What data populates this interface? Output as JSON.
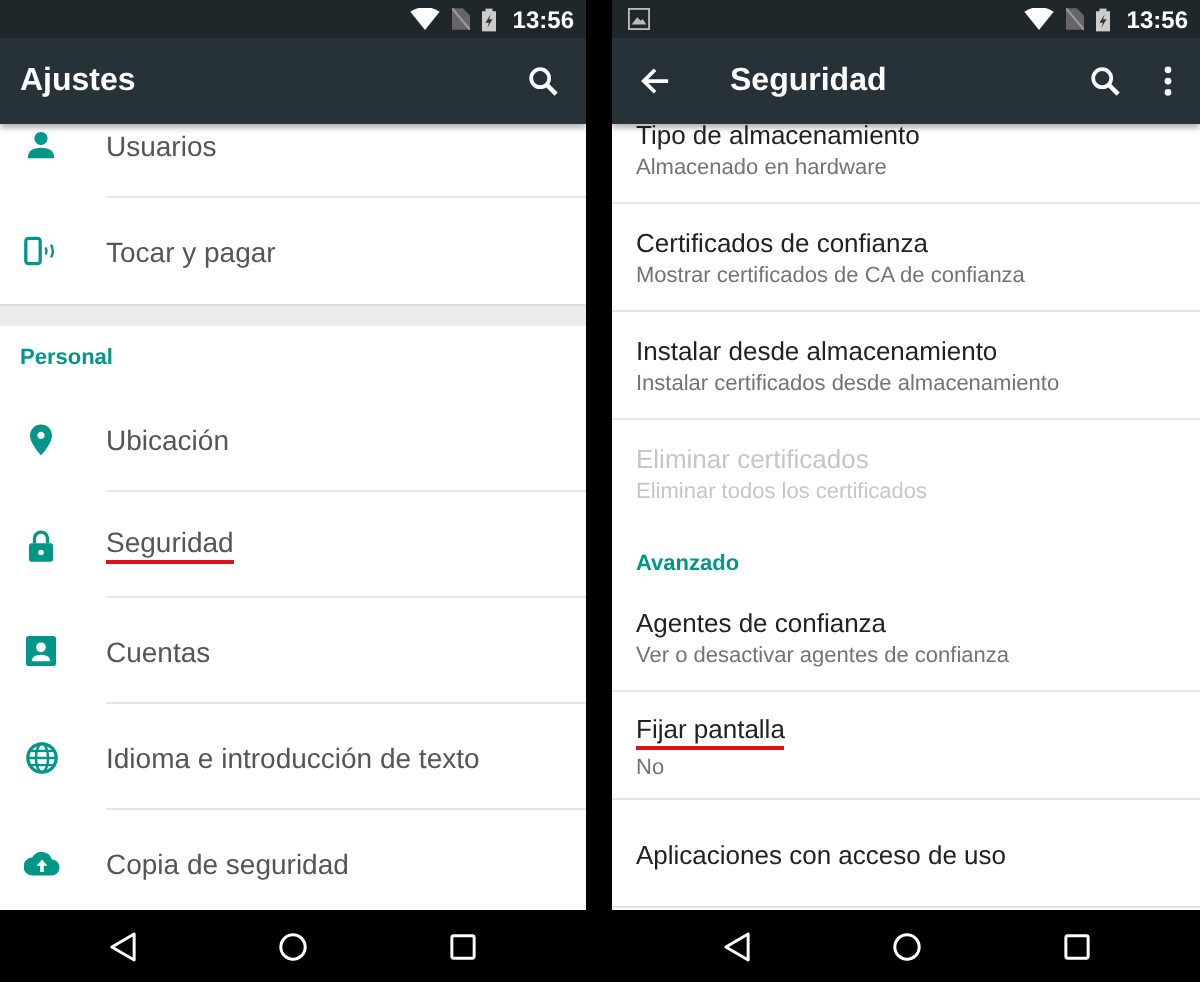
{
  "screens": [
    {
      "status_bar": {
        "time": "13:56",
        "has_notification": false
      },
      "toolbar": {
        "title": "Ajustes",
        "back_button": false,
        "search_button": true,
        "overflow_menu": false
      },
      "items": [
        {
          "kind": "row",
          "title": "Usuarios",
          "underlined": false,
          "disabled": false
        },
        {
          "kind": "row",
          "title": "Tocar y pagar",
          "underlined": false,
          "disabled": false
        },
        {
          "kind": "break"
        },
        {
          "kind": "header",
          "title": "Personal"
        },
        {
          "kind": "row",
          "title": "Ubicación",
          "underlined": false,
          "disabled": false
        },
        {
          "kind": "row",
          "title": "Seguridad",
          "underlined": true,
          "disabled": false
        },
        {
          "kind": "row",
          "title": "Cuentas",
          "underlined": false,
          "disabled": false
        },
        {
          "kind": "row",
          "title": "Idioma e introducción de texto",
          "underlined": false,
          "disabled": false
        },
        {
          "kind": "row",
          "title": "Copia de seguridad",
          "underlined": false,
          "disabled": false
        }
      ]
    },
    {
      "status_bar": {
        "time": "13:56",
        "has_notification": true
      },
      "toolbar": {
        "title": "Seguridad",
        "back_button": true,
        "search_button": true,
        "overflow_menu": true
      },
      "items": [
        {
          "kind": "row",
          "title": "Tipo de almacenamiento",
          "subtitle": "Almacenado en hardware",
          "underlined": false,
          "disabled": false
        },
        {
          "kind": "row",
          "title": "Certificados de confianza",
          "subtitle": "Mostrar certificados de CA de confianza",
          "underlined": false,
          "disabled": false
        },
        {
          "kind": "row",
          "title": "Instalar desde almacenamiento",
          "subtitle": "Instalar certificados desde almacenamiento",
          "underlined": false,
          "disabled": false
        },
        {
          "kind": "row",
          "title": "Eliminar certificados",
          "subtitle": "Eliminar todos los certificados",
          "underlined": false,
          "disabled": true
        },
        {
          "kind": "header",
          "title": "Avanzado"
        },
        {
          "kind": "row",
          "title": "Agentes de confianza",
          "subtitle": "Ver o desactivar agentes de confianza",
          "underlined": false,
          "disabled": false
        },
        {
          "kind": "row",
          "title": "Fijar pantalla",
          "subtitle": "No",
          "underlined": true,
          "disabled": false
        },
        {
          "kind": "row",
          "title": "Aplicaciones con acceso de uso",
          "underlined": false,
          "disabled": false
        }
      ]
    }
  ]
}
